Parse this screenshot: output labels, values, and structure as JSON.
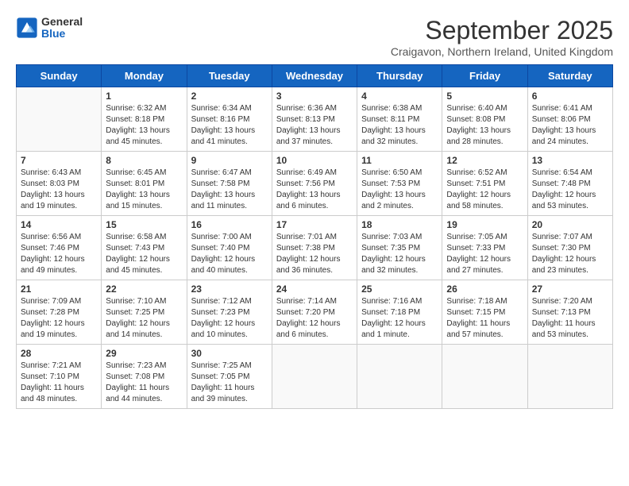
{
  "header": {
    "logo_general": "General",
    "logo_blue": "Blue",
    "title": "September 2025",
    "subtitle": "Craigavon, Northern Ireland, United Kingdom"
  },
  "weekdays": [
    "Sunday",
    "Monday",
    "Tuesday",
    "Wednesday",
    "Thursday",
    "Friday",
    "Saturday"
  ],
  "weeks": [
    [
      {
        "day": "",
        "info": ""
      },
      {
        "day": "1",
        "info": "Sunrise: 6:32 AM\nSunset: 8:18 PM\nDaylight: 13 hours\nand 45 minutes."
      },
      {
        "day": "2",
        "info": "Sunrise: 6:34 AM\nSunset: 8:16 PM\nDaylight: 13 hours\nand 41 minutes."
      },
      {
        "day": "3",
        "info": "Sunrise: 6:36 AM\nSunset: 8:13 PM\nDaylight: 13 hours\nand 37 minutes."
      },
      {
        "day": "4",
        "info": "Sunrise: 6:38 AM\nSunset: 8:11 PM\nDaylight: 13 hours\nand 32 minutes."
      },
      {
        "day": "5",
        "info": "Sunrise: 6:40 AM\nSunset: 8:08 PM\nDaylight: 13 hours\nand 28 minutes."
      },
      {
        "day": "6",
        "info": "Sunrise: 6:41 AM\nSunset: 8:06 PM\nDaylight: 13 hours\nand 24 minutes."
      }
    ],
    [
      {
        "day": "7",
        "info": "Sunrise: 6:43 AM\nSunset: 8:03 PM\nDaylight: 13 hours\nand 19 minutes."
      },
      {
        "day": "8",
        "info": "Sunrise: 6:45 AM\nSunset: 8:01 PM\nDaylight: 13 hours\nand 15 minutes."
      },
      {
        "day": "9",
        "info": "Sunrise: 6:47 AM\nSunset: 7:58 PM\nDaylight: 13 hours\nand 11 minutes."
      },
      {
        "day": "10",
        "info": "Sunrise: 6:49 AM\nSunset: 7:56 PM\nDaylight: 13 hours\nand 6 minutes."
      },
      {
        "day": "11",
        "info": "Sunrise: 6:50 AM\nSunset: 7:53 PM\nDaylight: 13 hours\nand 2 minutes."
      },
      {
        "day": "12",
        "info": "Sunrise: 6:52 AM\nSunset: 7:51 PM\nDaylight: 12 hours\nand 58 minutes."
      },
      {
        "day": "13",
        "info": "Sunrise: 6:54 AM\nSunset: 7:48 PM\nDaylight: 12 hours\nand 53 minutes."
      }
    ],
    [
      {
        "day": "14",
        "info": "Sunrise: 6:56 AM\nSunset: 7:46 PM\nDaylight: 12 hours\nand 49 minutes."
      },
      {
        "day": "15",
        "info": "Sunrise: 6:58 AM\nSunset: 7:43 PM\nDaylight: 12 hours\nand 45 minutes."
      },
      {
        "day": "16",
        "info": "Sunrise: 7:00 AM\nSunset: 7:40 PM\nDaylight: 12 hours\nand 40 minutes."
      },
      {
        "day": "17",
        "info": "Sunrise: 7:01 AM\nSunset: 7:38 PM\nDaylight: 12 hours\nand 36 minutes."
      },
      {
        "day": "18",
        "info": "Sunrise: 7:03 AM\nSunset: 7:35 PM\nDaylight: 12 hours\nand 32 minutes."
      },
      {
        "day": "19",
        "info": "Sunrise: 7:05 AM\nSunset: 7:33 PM\nDaylight: 12 hours\nand 27 minutes."
      },
      {
        "day": "20",
        "info": "Sunrise: 7:07 AM\nSunset: 7:30 PM\nDaylight: 12 hours\nand 23 minutes."
      }
    ],
    [
      {
        "day": "21",
        "info": "Sunrise: 7:09 AM\nSunset: 7:28 PM\nDaylight: 12 hours\nand 19 minutes."
      },
      {
        "day": "22",
        "info": "Sunrise: 7:10 AM\nSunset: 7:25 PM\nDaylight: 12 hours\nand 14 minutes."
      },
      {
        "day": "23",
        "info": "Sunrise: 7:12 AM\nSunset: 7:23 PM\nDaylight: 12 hours\nand 10 minutes."
      },
      {
        "day": "24",
        "info": "Sunrise: 7:14 AM\nSunset: 7:20 PM\nDaylight: 12 hours\nand 6 minutes."
      },
      {
        "day": "25",
        "info": "Sunrise: 7:16 AM\nSunset: 7:18 PM\nDaylight: 12 hours\nand 1 minute."
      },
      {
        "day": "26",
        "info": "Sunrise: 7:18 AM\nSunset: 7:15 PM\nDaylight: 11 hours\nand 57 minutes."
      },
      {
        "day": "27",
        "info": "Sunrise: 7:20 AM\nSunset: 7:13 PM\nDaylight: 11 hours\nand 53 minutes."
      }
    ],
    [
      {
        "day": "28",
        "info": "Sunrise: 7:21 AM\nSunset: 7:10 PM\nDaylight: 11 hours\nand 48 minutes."
      },
      {
        "day": "29",
        "info": "Sunrise: 7:23 AM\nSunset: 7:08 PM\nDaylight: 11 hours\nand 44 minutes."
      },
      {
        "day": "30",
        "info": "Sunrise: 7:25 AM\nSunset: 7:05 PM\nDaylight: 11 hours\nand 39 minutes."
      },
      {
        "day": "",
        "info": ""
      },
      {
        "day": "",
        "info": ""
      },
      {
        "day": "",
        "info": ""
      },
      {
        "day": "",
        "info": ""
      }
    ]
  ]
}
